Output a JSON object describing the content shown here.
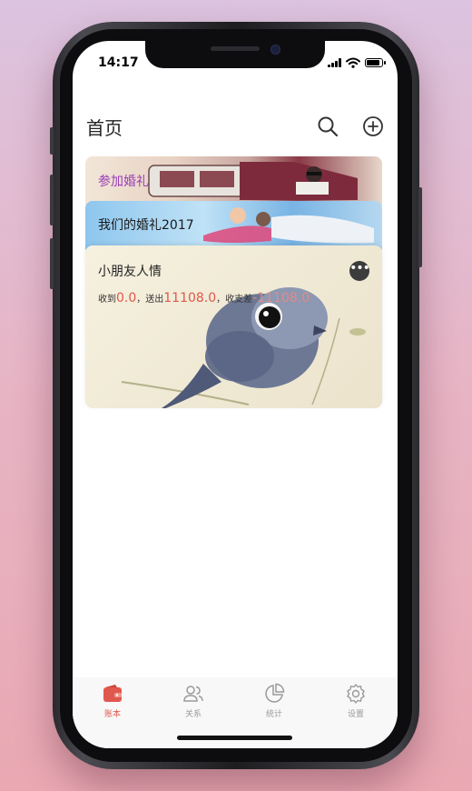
{
  "status_bar": {
    "time": "14:17"
  },
  "header": {
    "title": "首页",
    "search_icon": "search-icon",
    "add_icon": "plus-circle-icon"
  },
  "books": [
    {
      "label": "参加婚礼"
    },
    {
      "label": "我们的婚礼2017"
    },
    {
      "label": "小朋友人情",
      "stats": {
        "received_label": "收到",
        "received_value": "0.0",
        "sep": "，",
        "sent_label": "送出",
        "sent_value": "11108.0",
        "sep2": "，",
        "balance_label": "收支差",
        "balance_value": "-11108.0"
      }
    }
  ],
  "tabs": [
    {
      "label": "账本",
      "icon": "wallet-icon",
      "active": true
    },
    {
      "label": "关系",
      "icon": "people-icon",
      "active": false
    },
    {
      "label": "统计",
      "icon": "pie-chart-icon",
      "active": false
    },
    {
      "label": "设置",
      "icon": "gear-icon",
      "active": false
    }
  ],
  "colors": {
    "accent": "#e0574d",
    "inactive_tab": "#9a9a9a",
    "wedding_label": "#9a3fb8"
  }
}
